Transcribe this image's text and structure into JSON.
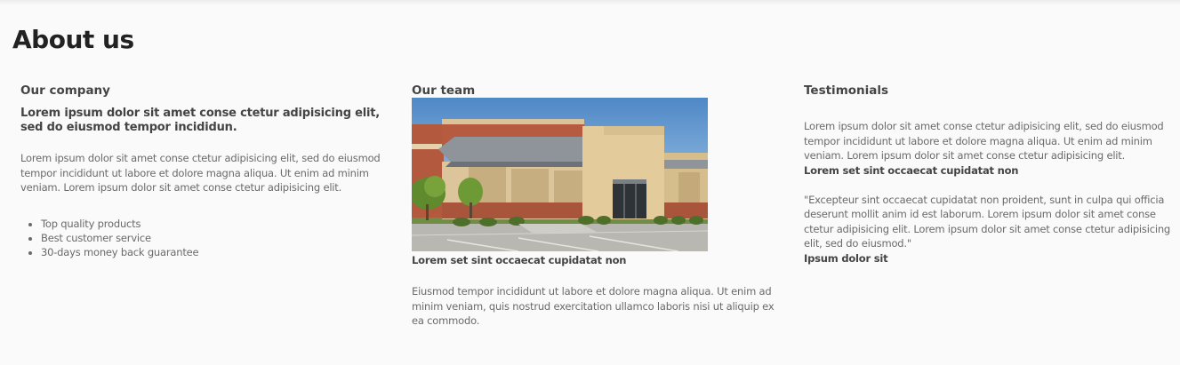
{
  "page": {
    "title": "About us"
  },
  "company": {
    "heading": "Our company",
    "lead": "Lorem ipsum dolor sit amet conse ctetur adipisicing elit, sed do eiusmod tempor incididun.",
    "body": "Lorem ipsum dolor sit amet conse ctetur adipisicing elit, sed do eiusmod tempor incididunt ut labore et dolore magna aliqua. Ut enim ad minim veniam. Lorem ipsum dolor sit amet conse ctetur adipisicing elit.",
    "features": [
      "Top quality products",
      "Best customer service",
      "30-days money back guarantee"
    ]
  },
  "team": {
    "heading": "Our team",
    "photo_icon": "building-photo",
    "caption": "Lorem set sint occaecat cupidatat non",
    "body": "Eiusmod tempor incididunt ut labore et dolore magna aliqua. Ut enim ad minim veniam, quis nostrud exercitation ullamco laboris nisi ut aliquip ex ea commodo."
  },
  "testimonials": {
    "heading": "Testimonials",
    "items": [
      {
        "quote": "Lorem ipsum dolor sit amet conse ctetur adipisicing elit, sed do eiusmod tempor incididunt ut labore et dolore magna aliqua. Ut enim ad minim veniam. Lorem ipsum dolor sit amet conse ctetur adipisicing elit.",
        "author": "Lorem set sint occaecat cupidatat non"
      },
      {
        "quote": "\"Excepteur sint occaecat cupidatat non proident, sunt in culpa qui officia deserunt mollit anim id est laborum. Lorem ipsum dolor sit amet conse ctetur adipisicing elit. Lorem ipsum dolor sit amet conse ctetur adipisicing elit, sed do eiusmod.\"",
        "author": "Ipsum dolor sit"
      }
    ]
  }
}
